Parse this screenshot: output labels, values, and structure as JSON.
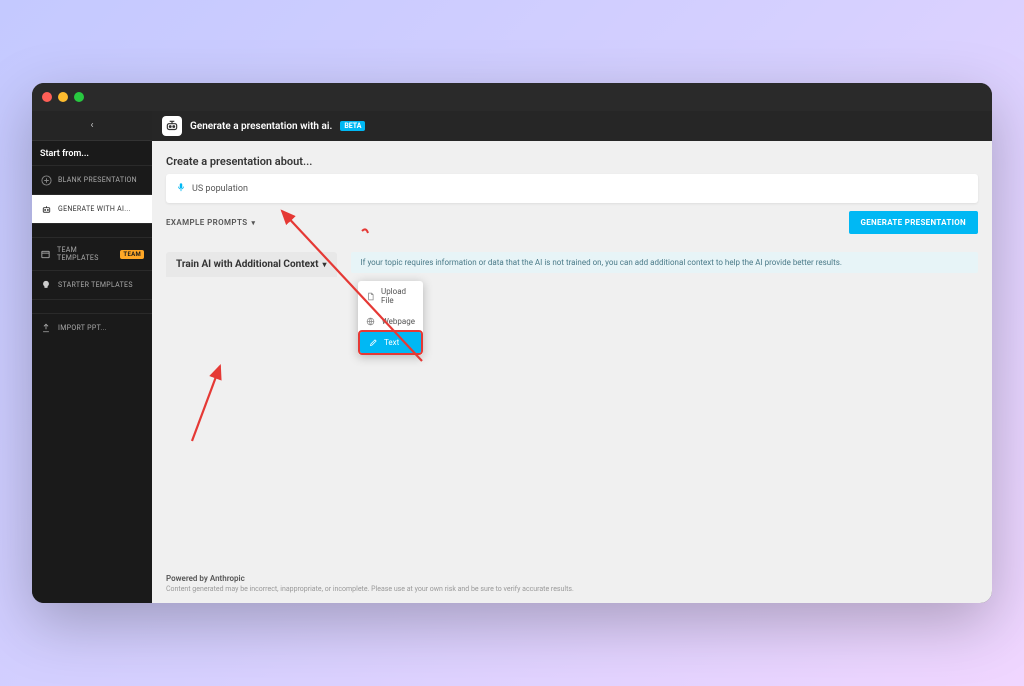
{
  "header": {
    "title": "Generate a presentation with ai.",
    "beta_label": "BETA"
  },
  "sidebar": {
    "section_label": "Start from...",
    "items": [
      {
        "label": "BLANK PRESENTATION",
        "icon": "plus-circle"
      },
      {
        "label": "GENERATE WITH AI...",
        "icon": "robot",
        "active": true
      },
      {
        "label": "TEAM TEMPLATES",
        "icon": "team",
        "badge": "TEAM"
      },
      {
        "label": "STARTER TEMPLATES",
        "icon": "lightbulb"
      },
      {
        "label": "IMPORT PPT...",
        "icon": "upload"
      }
    ]
  },
  "create": {
    "label": "Create a presentation about...",
    "input_value": "US population",
    "example_prompts_label": "EXAMPLE PROMPTS",
    "generate_label": "GENERATE PRESENTATION"
  },
  "train": {
    "label": "Train AI with Additional Context",
    "hint": "If your topic requires information or data that the AI is not trained on, you can add additional context to help the AI provide better results.",
    "options": [
      {
        "label": "Upload File",
        "icon": "file"
      },
      {
        "label": "Webpage",
        "icon": "globe"
      },
      {
        "label": "Text",
        "icon": "pencil",
        "selected": true
      }
    ]
  },
  "footer": {
    "powered": "Powered by Anthropic",
    "disclaimer": "Content generated may be incorrect, inappropriate, or incomplete. Please use at your own risk and be sure to verify accurate results."
  }
}
